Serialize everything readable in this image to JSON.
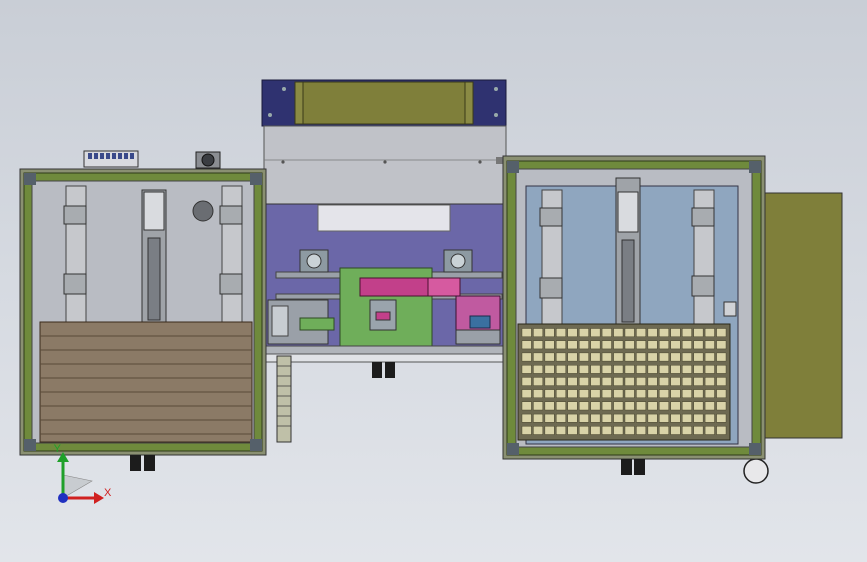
{
  "view": {
    "background_top": "#c9ced6",
    "background_bottom": "#e2e5ea"
  },
  "colors": {
    "frame_green": "#6f8a3c",
    "panel_gray": "#b9bcc3",
    "blue_panel": "#8fa6bf",
    "purple_panel": "#6b67a8",
    "olive": "#7f7f3a",
    "navy": "#2f3270",
    "pcb_green": "#6fae5a",
    "magenta": "#c2408a",
    "tray_wood": "#8b7a66",
    "tray_cream": "#d9d3a8"
  },
  "triad": {
    "x_label": "X",
    "y_label": "Y",
    "x_color": "#d02020",
    "y_color": "#1fa02a",
    "z_color": "#2030c0"
  },
  "tray": {
    "rows": 9,
    "cols": 18
  }
}
